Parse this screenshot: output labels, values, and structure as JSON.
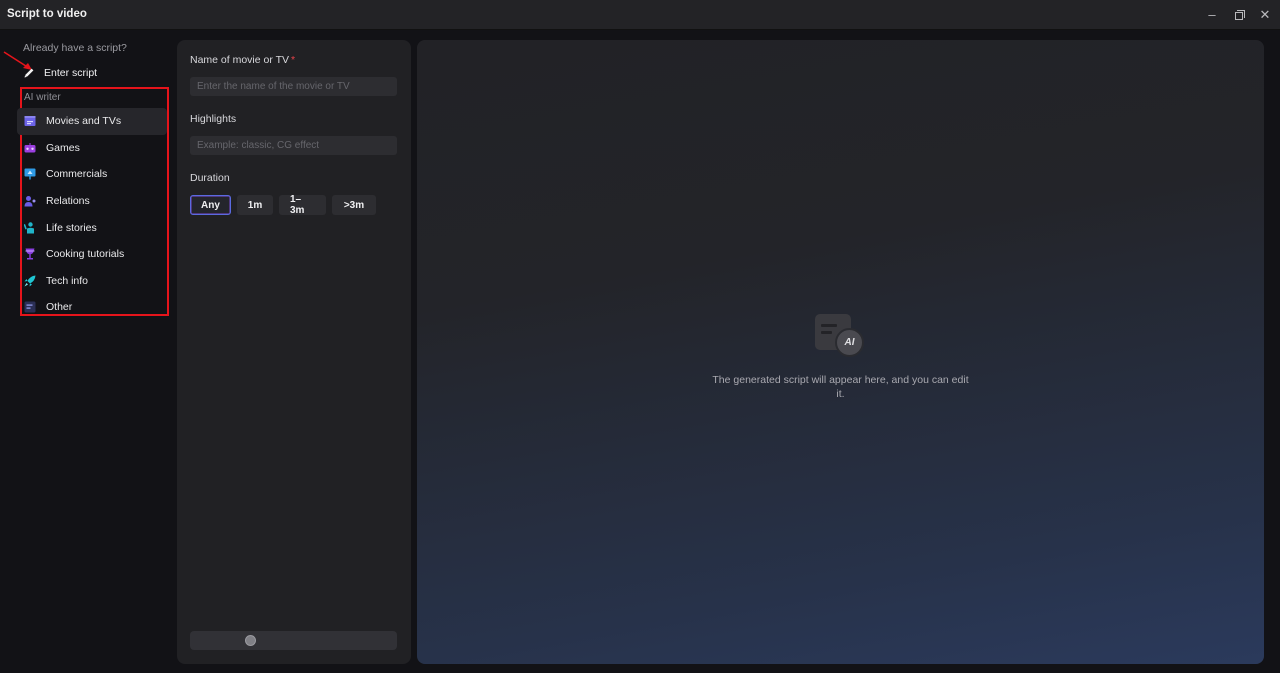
{
  "window": {
    "title": "Script to video",
    "minimize_label": "–",
    "close_label": "✕"
  },
  "sidebar": {
    "already_have_script": "Already have a script?",
    "enter_script_label": "Enter script",
    "ai_writer_label": "AI writer",
    "categories": [
      {
        "label": "Movies and TVs",
        "icon": "clapperboard-icon",
        "color": "#6c63e8",
        "active": true
      },
      {
        "label": "Games",
        "icon": "gamepad-icon",
        "color": "#9b3fe0",
        "active": false
      },
      {
        "label": "Commercials",
        "icon": "billboard-icon",
        "color": "#2f9be6",
        "active": false
      },
      {
        "label": "Relations",
        "icon": "people-icon",
        "color": "#6a5ce6",
        "active": false
      },
      {
        "label": "Life stories",
        "icon": "person-waving-icon",
        "color": "#20b5c9",
        "active": false
      },
      {
        "label": "Cooking tutorials",
        "icon": "goblet-icon",
        "color": "#8a3ee0",
        "active": false
      },
      {
        "label": "Tech info",
        "icon": "rocket-icon",
        "color": "#1fc6d3",
        "active": false
      },
      {
        "label": "Other",
        "icon": "document-edit-icon",
        "color": "#4a58c8",
        "active": false
      }
    ]
  },
  "form": {
    "name_label": "Name of movie or TV",
    "required_mark": "*",
    "name_placeholder": "Enter the name of the movie or TV",
    "name_value": "",
    "highlights_label": "Highlights",
    "highlights_placeholder": "Example: classic, CG effect",
    "highlights_value": "",
    "duration_label": "Duration",
    "duration_options": [
      {
        "label": "Any",
        "selected": true
      },
      {
        "label": "1m",
        "selected": false
      },
      {
        "label": "1–3m",
        "selected": false
      },
      {
        "label": ">3m",
        "selected": false
      }
    ]
  },
  "preview": {
    "ai_badge": "AI",
    "empty_message": "The generated script will appear here, and you can edit it."
  },
  "colors": {
    "highlight_box": "#e5141b",
    "required": "#e8434a",
    "selected_border": "#5a6be0"
  }
}
